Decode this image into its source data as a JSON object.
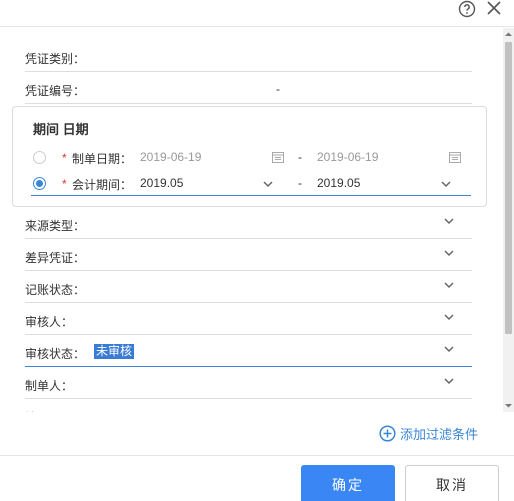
{
  "header": {
    "help_icon": "help-circle-icon",
    "close_icon": "close-icon"
  },
  "fields": {
    "voucher_type": "凭证类别：",
    "voucher_number": "凭证编号：",
    "voucher_number_sep": "-",
    "source_type": "来源类型：",
    "diff_voucher": "差异凭证：",
    "posting_status": "记账状态：",
    "reviewer": "审核人：",
    "review_status": "审核状态：",
    "review_status_value": "未审核",
    "creator": "制单人：",
    "partial": "摘要"
  },
  "date_panel": {
    "title": "期间 日期",
    "row1": {
      "required": "*",
      "label": "制单日期：",
      "from": "2019-06-19",
      "sep": "-",
      "to": "2019-06-19",
      "selected": false
    },
    "row2": {
      "required": "*",
      "label": "会计期间：",
      "from": "2019.05",
      "sep": "-",
      "to": "2019.05",
      "selected": true
    }
  },
  "add_filter": "添加过滤条件",
  "buttons": {
    "ok": "确定",
    "cancel": "取消"
  },
  "colors": {
    "accent": "#3a86d6",
    "primary_button": "#3a86f5",
    "required": "#e0352b"
  }
}
